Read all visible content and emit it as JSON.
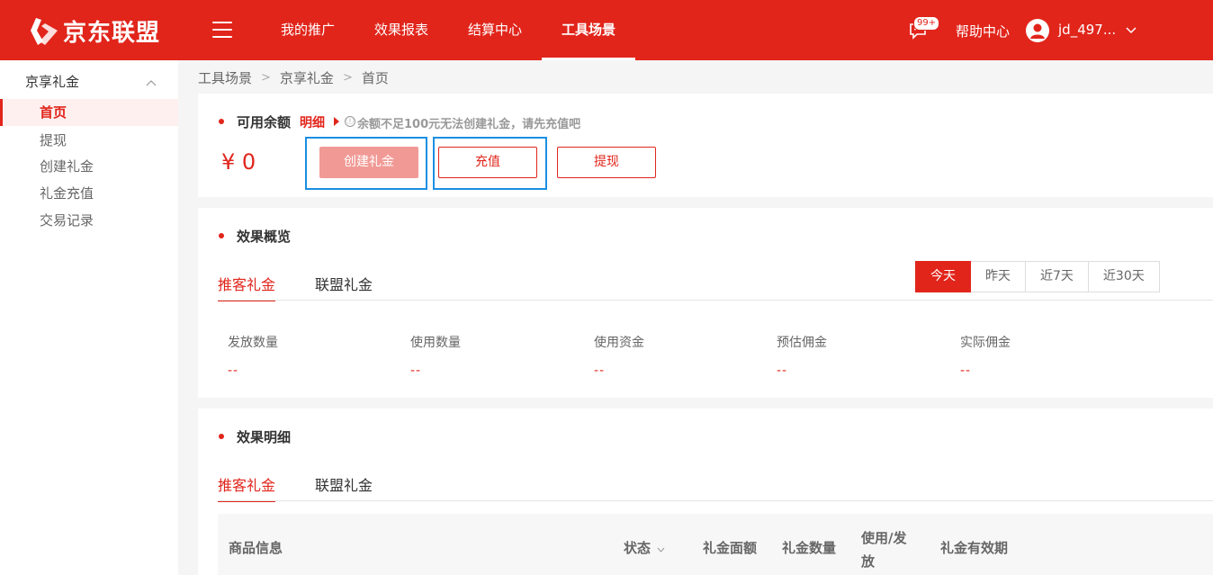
{
  "header": {
    "logo_text": "京东联盟",
    "nav": [
      {
        "label": "我的推广",
        "active": false
      },
      {
        "label": "效果报表",
        "active": false
      },
      {
        "label": "结算中心",
        "active": false
      },
      {
        "label": "工具场景",
        "active": true
      }
    ],
    "message_badge": "99+",
    "help_label": "帮助中心",
    "username": "jd_497..."
  },
  "sidebar": {
    "group_label": "京享礼金",
    "items": [
      {
        "label": "首页",
        "active": true
      },
      {
        "label": "提现",
        "active": false
      },
      {
        "label": "创建礼金",
        "active": false
      },
      {
        "label": "礼金充值",
        "active": false
      },
      {
        "label": "交易记录",
        "active": false
      }
    ]
  },
  "breadcrumb": [
    "工具场景",
    "京享礼金",
    "首页"
  ],
  "balance_card": {
    "title": "可用余额",
    "detail_link": "明细",
    "tip_icon": "ⓘ",
    "tip": "余额不足100元无法创建礼金，请先充值吧",
    "amount": "¥ 0",
    "buttons": {
      "create": "创建礼金",
      "recharge": "充值",
      "withdraw": "提现"
    }
  },
  "overview": {
    "title": "效果概览",
    "tabs": [
      "推客礼金",
      "联盟礼金"
    ],
    "ranges": [
      "今天",
      "昨天",
      "近7天",
      "近30天"
    ],
    "metrics": [
      {
        "label": "发放数量",
        "value": "--"
      },
      {
        "label": "使用数量",
        "value": "--"
      },
      {
        "label": "使用资金",
        "value": "--"
      },
      {
        "label": "预估佣金",
        "value": "--"
      },
      {
        "label": "实际佣金",
        "value": "--"
      }
    ]
  },
  "details": {
    "title": "效果明细",
    "tabs": [
      "推客礼金",
      "联盟礼金"
    ],
    "columns": {
      "product": "商品信息",
      "status": "状态",
      "amount": "礼金面额",
      "count": "礼金数量",
      "use_issue_1": "使用/发",
      "use_issue_2": "放",
      "validity": "礼金有效期"
    }
  },
  "colors": {
    "brand_red": "#e1251b",
    "focus_blue": "#1a8fe3"
  }
}
